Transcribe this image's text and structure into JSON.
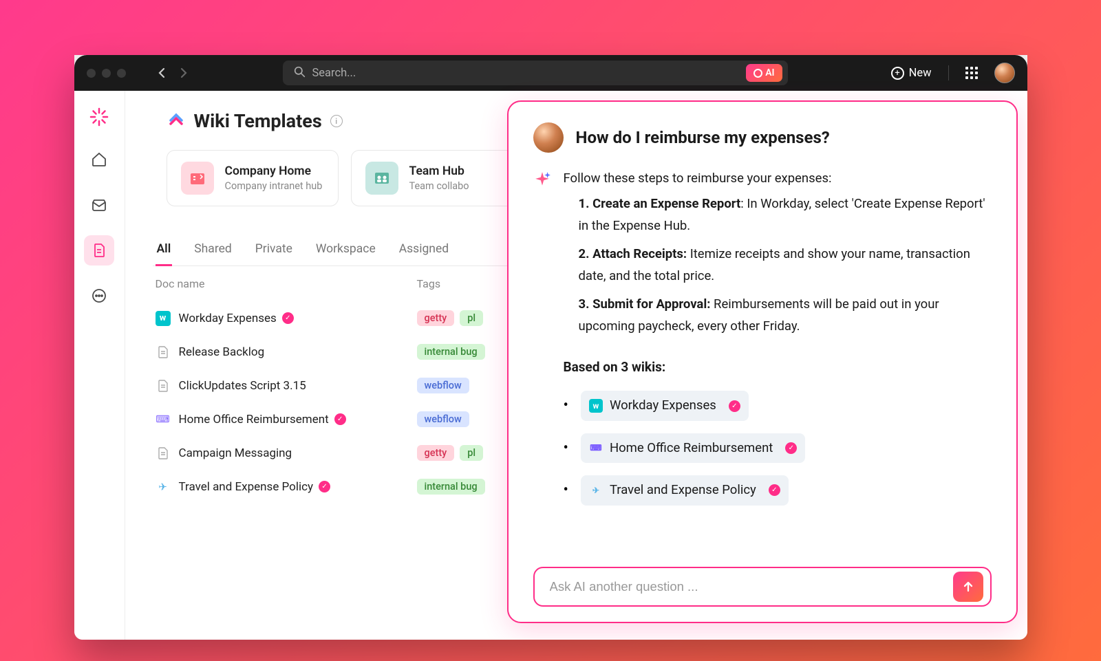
{
  "titlebar": {
    "search_placeholder": "Search...",
    "ai_label": "AI",
    "new_label": "New"
  },
  "page": {
    "title": "Wiki Templates"
  },
  "templates": [
    {
      "title": "Company Home",
      "subtitle": "Company intranet hub",
      "icon": "company"
    },
    {
      "title": "Team Hub",
      "subtitle": "Team collabo",
      "icon": "team"
    }
  ],
  "tabs": [
    "All",
    "Shared",
    "Private",
    "Workspace",
    "Assigned"
  ],
  "active_tab": "All",
  "columns": {
    "name": "Doc name",
    "tags": "Tags"
  },
  "docs": [
    {
      "icon": "workday",
      "name": "Workday Expenses",
      "verified": true,
      "tags": [
        {
          "label": "getty",
          "cls": "tag-getty"
        },
        {
          "label": "pl",
          "cls": "tag-pl"
        }
      ]
    },
    {
      "icon": "doc",
      "name": "Release Backlog",
      "verified": false,
      "tags": [
        {
          "label": "internal bug",
          "cls": "tag-internal"
        }
      ]
    },
    {
      "icon": "doc",
      "name": "ClickUpdates Script 3.15",
      "verified": false,
      "tags": [
        {
          "label": "webflow",
          "cls": "tag-webflow"
        }
      ]
    },
    {
      "icon": "keys",
      "name": "Home Office Reimbursement",
      "verified": true,
      "tags": [
        {
          "label": "webflow",
          "cls": "tag-webflow"
        }
      ]
    },
    {
      "icon": "doc",
      "name": "Campaign Messaging",
      "verified": false,
      "tags": [
        {
          "label": "getty",
          "cls": "tag-getty"
        },
        {
          "label": "pl",
          "cls": "tag-pl"
        }
      ]
    },
    {
      "icon": "plane",
      "name": "Travel and Expense Policy",
      "verified": true,
      "tags": [
        {
          "label": "internal bug",
          "cls": "tag-internal"
        }
      ]
    }
  ],
  "ai_panel": {
    "question": "How do I reimburse my expenses?",
    "intro": "Follow these steps to reimburse your expenses:",
    "steps": [
      {
        "n": "1.",
        "title": "Create an Expense Report",
        "body": ": In Workday, select 'Create Expense Report' in the Expense Hub."
      },
      {
        "n": "2.",
        "title": "Attach Receipts:",
        "body": " Itemize receipts and show your name, transaction date, and the total price."
      },
      {
        "n": "3.",
        "title": "Submit for Approval:",
        "body": "  Reimbursements will be paid out in your upcoming paycheck, every other Friday."
      }
    ],
    "based_on_title": "Based on 3 wikis:",
    "wikis": [
      {
        "icon": "workday",
        "name": "Workday Expenses"
      },
      {
        "icon": "keys",
        "name": "Home Office Reimbursement"
      },
      {
        "icon": "plane",
        "name": "Travel and Expense Policy"
      }
    ],
    "input_placeholder": "Ask AI another question ..."
  }
}
